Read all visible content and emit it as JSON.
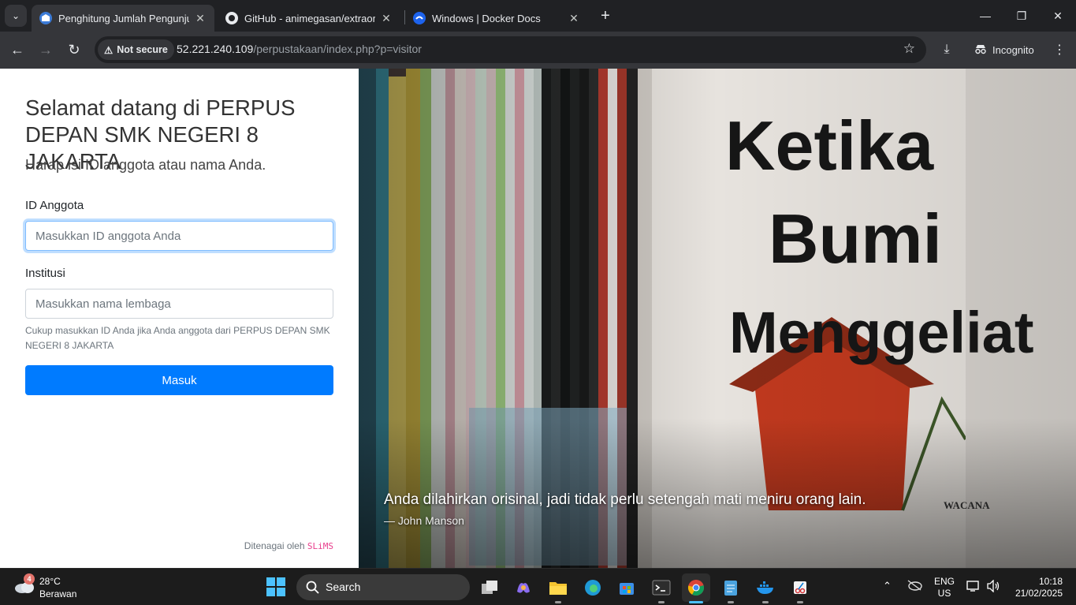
{
  "browser": {
    "tabs": [
      {
        "title": "Penghitung Jumlah Pengunjung",
        "active": true
      },
      {
        "title": "GitHub - animegasan/extraordin",
        "active": false
      },
      {
        "title": "Windows | Docker Docs",
        "active": false
      }
    ],
    "security_label": "Not secure",
    "url_host": "52.221.240.109",
    "url_path": "/perpustakaan/index.php?p=visitor",
    "incognito_label": "Incognito"
  },
  "page": {
    "welcome": "Selamat datang di PERPUS DEPAN SMK NEGERI 8 JAKARTA",
    "subtitle": "Harap isi ID anggota atau nama Anda.",
    "member_id_label": "ID Anggota",
    "member_id_placeholder": "Masukkan ID anggota Anda",
    "institution_label": "Institusi",
    "institution_placeholder": "Masukkan nama lembaga",
    "help_text": "Cukup masukkan ID Anda jika Anda anggota dari PERPUS DEPAN SMK NEGERI 8 JAKARTA",
    "submit_label": "Masuk",
    "powered_by": "Ditenagai oleh",
    "powered_brand": "SLiMS",
    "quote": "Anda dilahirkan orisinal, jadi tidak perlu setengah mati meniru orang lain.",
    "quote_author": "— John Manson",
    "book_title_lines": [
      "Ketika",
      "Bumi",
      "Menggeliat"
    ],
    "book_publisher": "WACANA"
  },
  "taskbar": {
    "weather_badge": "4",
    "temperature": "28°C",
    "condition": "Berawan",
    "search_label": "Search",
    "lang_top": "ENG",
    "lang_bottom": "US",
    "time": "10:18",
    "date": "21/02/2025"
  }
}
